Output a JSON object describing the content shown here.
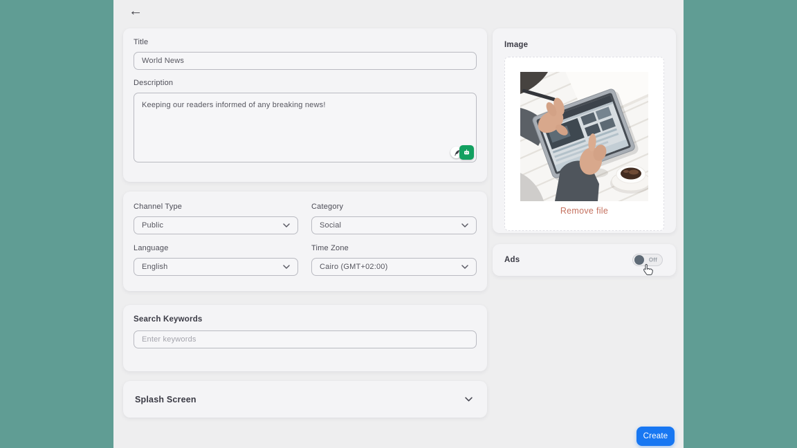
{
  "window": {
    "back_icon": "←"
  },
  "basics_card": {
    "title_label": "Title",
    "title_value": "World News",
    "description_label": "Description",
    "description_value": "Keeping our readers informed of any breaking news!"
  },
  "settings_card": {
    "channel_type_label": "Channel Type",
    "channel_type_value": "Public",
    "category_label": "Category",
    "category_value": "Social",
    "language_label": "Language",
    "language_value": "English",
    "time_zone_label": "Time Zone",
    "time_zone_value": "Cairo (GMT+02:00)"
  },
  "keywords_card": {
    "label": "Search Keywords",
    "placeholder": "Enter keywords"
  },
  "splash_card": {
    "label": "Splash Screen"
  },
  "image_card": {
    "label": "Image",
    "remove_file_label": "Remove file",
    "photo_description": "Person browsing a news site on a tablet at a white wooden desk with coffee"
  },
  "ads_card": {
    "label": "Ads",
    "toggle_state": "Off"
  },
  "footer": {
    "create_label": "Create"
  },
  "colors": {
    "background_teal": "#609d94",
    "accent_blue": "#1877f2",
    "remove_link": "#c4705e",
    "extension_green": "#12a060"
  }
}
